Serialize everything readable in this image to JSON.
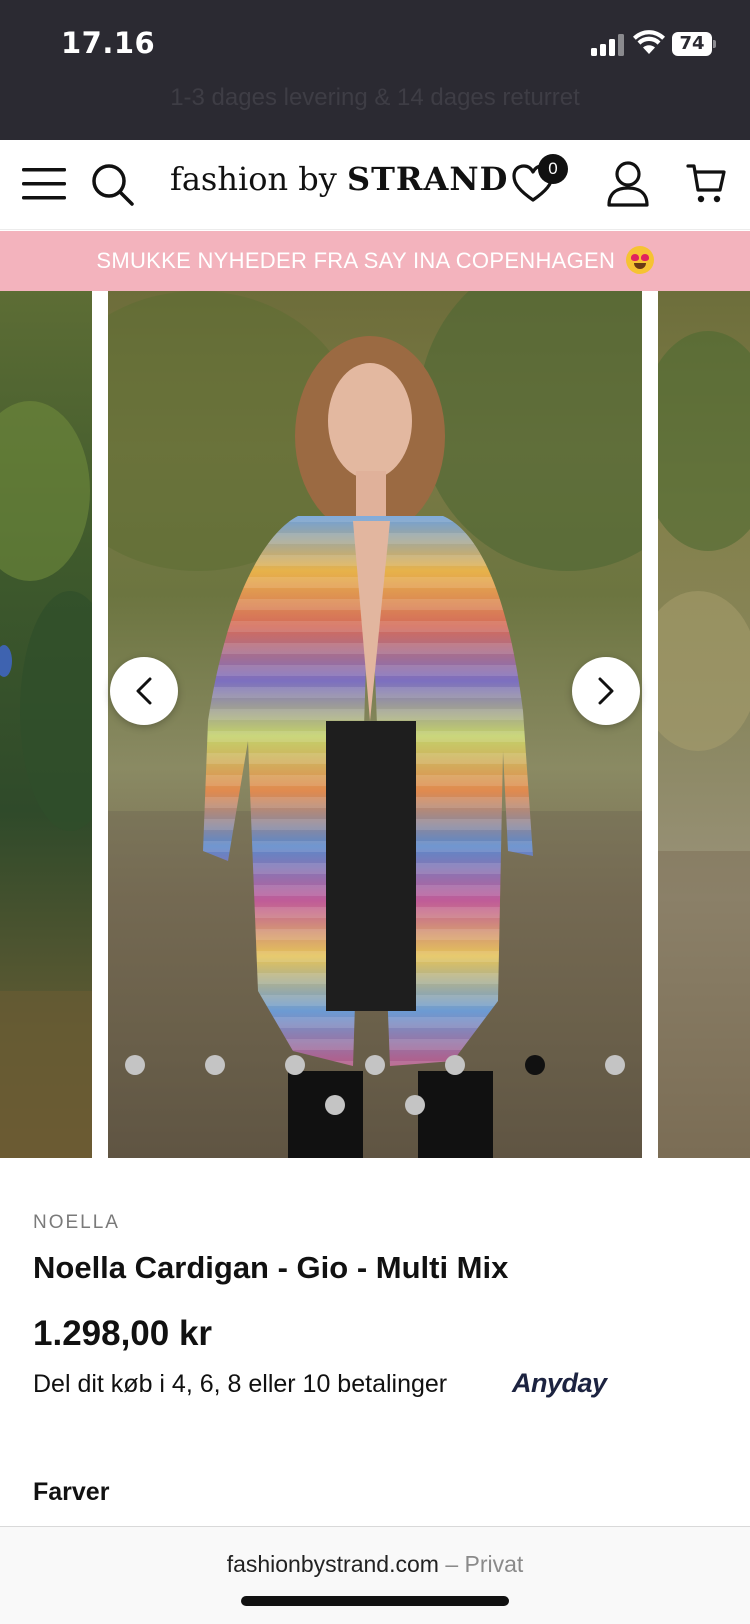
{
  "status_bar": {
    "time": "17.16",
    "battery": "74",
    "icons": [
      "cellular-signal-icon",
      "wifi-icon",
      "battery-icon"
    ]
  },
  "announcement": "1-3 dages levering & 14 dages returret",
  "header": {
    "logo_light": "fashion by ",
    "logo_bold": "STRAND",
    "wishlist_count": "0",
    "icons": [
      "menu-icon",
      "search-icon",
      "heart-icon",
      "account-icon",
      "cart-icon"
    ]
  },
  "promo_banner": "SMUKKE NYHEDER FRA SAY INA COPENHAGEN",
  "gallery": {
    "total_images": 9,
    "active_index": 5
  },
  "product": {
    "brand": "NOELLA",
    "title": "Noella Cardigan - Gio - Multi Mix",
    "price": "1.298,00 kr",
    "installments": "Del dit køb i 4, 6, 8 eller 10 betalinger",
    "payment_provider": "Anyday",
    "colors_label": "Farver"
  },
  "browser": {
    "domain": "fashionbystrand.com",
    "separator": "–",
    "mode": "Privat"
  },
  "colors": {
    "status_bg": "#2b2a32",
    "promo_bg": "#f3b3bd",
    "active_dot": "#111111",
    "inactive_dot": "#c4c4c4"
  }
}
